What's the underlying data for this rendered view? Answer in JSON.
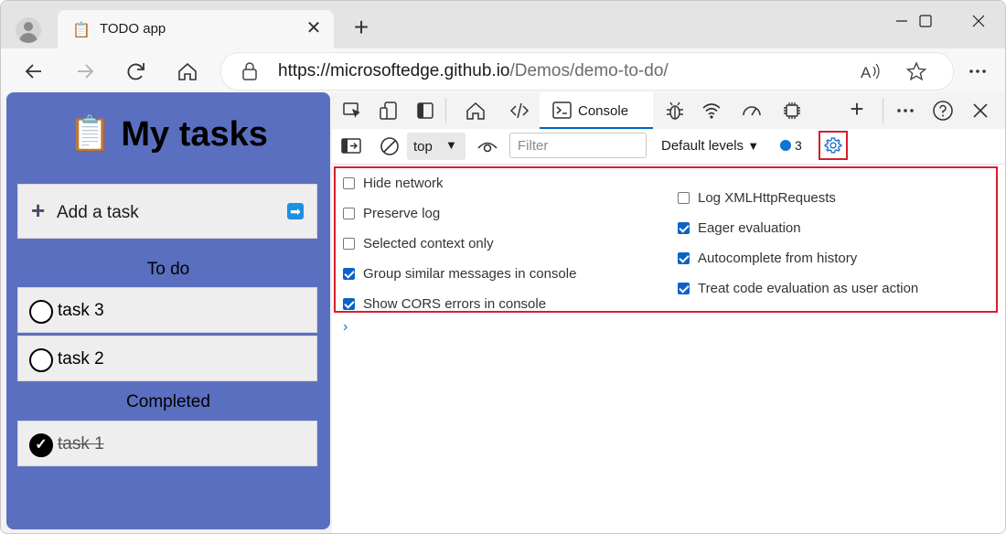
{
  "browser": {
    "tab": {
      "favicon": "📋",
      "title": "TODO app",
      "close": "✕"
    },
    "new_tab": "+",
    "url_host": "https://microsoftedge.github.io",
    "url_path": "/Demos/demo-to-do/"
  },
  "app": {
    "icon": "📋",
    "title": "My tasks",
    "add_task": {
      "plus": "+",
      "label": "Add a task",
      "go": "➡"
    },
    "todo_heading": "To do",
    "todo": [
      {
        "text": "task 3"
      },
      {
        "text": "task 2"
      }
    ],
    "completed_heading": "Completed",
    "completed": [
      {
        "text": "task 1",
        "check": "✓"
      }
    ]
  },
  "devtools": {
    "console_tab": "Console",
    "new_tab": "+",
    "context": "top",
    "filter_placeholder": "Filter",
    "levels": "Default levels",
    "message_count": "3",
    "settings": {
      "left": [
        {
          "label": "Hide network",
          "checked": false
        },
        {
          "label": "Preserve log",
          "checked": false
        },
        {
          "label": "Selected context only",
          "checked": false
        },
        {
          "label": "Group similar messages in console",
          "checked": true
        },
        {
          "label": "Show CORS errors in console",
          "checked": true
        }
      ],
      "right": [
        {
          "label": "Log XMLHttpRequests",
          "checked": false
        },
        {
          "label": "Eager evaluation",
          "checked": true
        },
        {
          "label": "Autocomplete from history",
          "checked": true
        },
        {
          "label": "Treat code evaluation as user action",
          "checked": true
        }
      ]
    },
    "prompt": "›"
  },
  "colors": {
    "app_bg": "#5b6fc0",
    "highlight": "#d4202c",
    "accent": "#0b63c9"
  }
}
